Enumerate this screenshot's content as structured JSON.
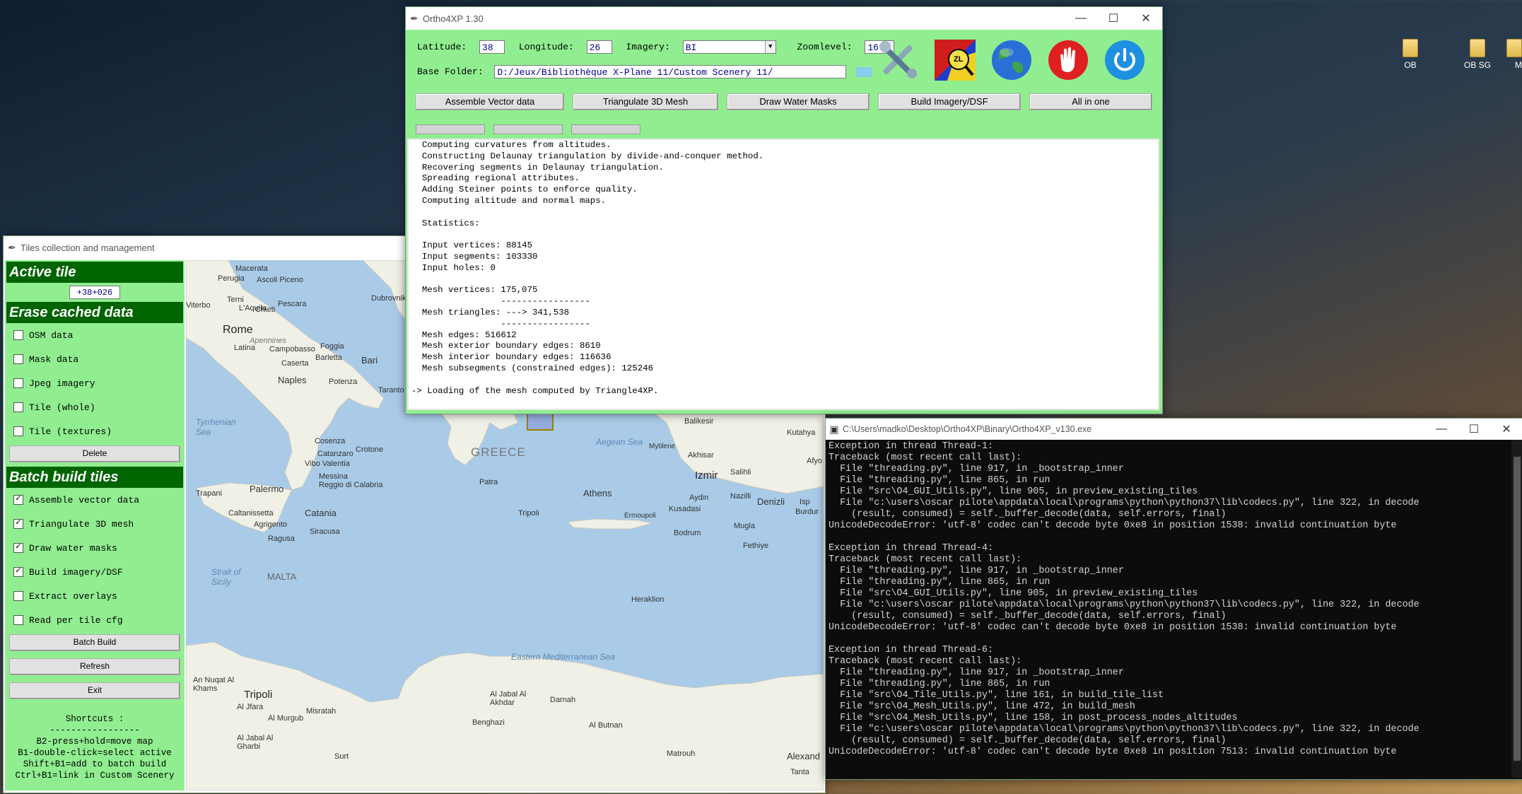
{
  "desktop": {
    "icons": [
      {
        "label": "OB"
      },
      {
        "label": "OB SG"
      },
      {
        "label": "M"
      }
    ]
  },
  "ortho": {
    "title": "Ortho4XP 1.30",
    "latitude_label": "Latitude:",
    "latitude_value": "38",
    "longitude_label": "Longitude:",
    "longitude_value": "26",
    "imagery_label": "Imagery:",
    "imagery_value": "BI",
    "zoom_label": "Zoomlevel:",
    "zoom_value": "16",
    "base_folder_label": "Base Folder:",
    "base_folder_value": "D:/Jeux/Bibliothèque X-Plane 11/Custom Scenery 11/",
    "buttons": {
      "assemble": "Assemble Vector data",
      "triangulate": "Triangulate 3D Mesh",
      "water": "Draw Water Masks",
      "build": "Build Imagery/DSF",
      "allinone": "All in one"
    },
    "zl_text": "ZL",
    "log": "  Computing curvatures from altitudes.\n  Constructing Delaunay triangulation by divide-and-conquer method.\n  Recovering segments in Delaunay triangulation.\n  Spreading regional attributes.\n  Adding Steiner points to enforce quality.\n  Computing altitude and normal maps.\n\n  Statistics:\n\n  Input vertices: 88145\n  Input segments: 103330\n  Input holes: 0\n\n  Mesh vertices: 175,075\n                 -----------------\n  Mesh triangles: ---> 341,538\n                 -----------------\n  Mesh edges: 516612\n  Mesh exterior boundary edges: 8610\n  Mesh interior boundary edges: 116636\n  Mesh subsegments (constrained edges): 125246\n\n-> Loading of the mesh computed by Triangle4XP."
  },
  "tiles": {
    "title": "Tiles collection and management",
    "active_tile_header": "Active tile",
    "active_tile_value": "+38+026",
    "erase_header": "Erase cached data",
    "erase_items": [
      "OSM data",
      "Mask data",
      "Jpeg imagery",
      "Tile (whole)",
      "Tile (textures)"
    ],
    "delete_label": "Delete",
    "batch_header": "Batch build tiles",
    "batch_items": [
      {
        "label": "Assemble vector data",
        "checked": "✓"
      },
      {
        "label": "Triangulate 3D mesh",
        "checked": "✓"
      },
      {
        "label": "Draw water masks",
        "checked": "✓"
      },
      {
        "label": "Build imagery/DSF",
        "checked": "✓"
      },
      {
        "label": "Extract overlays",
        "checked": ""
      },
      {
        "label": "Read per tile cfg",
        "checked": ""
      }
    ],
    "batch_build_label": "Batch Build",
    "refresh_label": "Refresh",
    "exit_label": "Exit",
    "shortcuts": [
      "Shortcuts :",
      "-----------------",
      "B2-press+hold=move map",
      "B1-double-click=select active",
      "Shift+B1=add to batch build",
      "Ctrl+B1=link in Custom Scenery"
    ],
    "map_labels": [
      "Macerata",
      "Perugia",
      "Ascoli Piceno",
      "Terni",
      "L'Aquila",
      "Chieti",
      "Pescara",
      "Viterbo",
      "Rome",
      "Apennines",
      "Latina",
      "Campobasso",
      "Foggia",
      "Barletta",
      "Bari",
      "Caserta",
      "Naples",
      "Potenza",
      "Taranto",
      "Cosenza",
      "Catanzaro",
      "Crotone",
      "Vibo Valentia",
      "Reggio di Calabria",
      "Messina",
      "Palermo",
      "Trapani",
      "Caltanissetta",
      "Agrigento",
      "Catania",
      "Ragusa",
      "Siracusa",
      "MALTA",
      "Dubrovnik",
      "GREECE",
      "Patra",
      "Athens",
      "Tripoli",
      "Ermoupoli",
      "Mytilene",
      "Balikesir",
      "Kutahya",
      "Akhisar",
      "Izmir",
      "Salihli",
      "Afyo",
      "Aydin",
      "Nazilli",
      "Denizli",
      "Isp",
      "Burdur",
      "Kusadasi",
      "Bodrum",
      "Mugla",
      "Fethiye",
      "Heraklion",
      "Tripoli",
      "Al Jfara",
      "Al Murgub",
      "Misratah",
      "Al Jabal Al Gharbi",
      "An Nuqat Al Khams",
      "Al Jabal Al Akhdar",
      "Darnah",
      "Benghazi",
      "Al Butnan",
      "Surt",
      "Matrouh",
      "Alexand",
      "Tanta"
    ],
    "sea_labels": [
      "Tyrrhenian Sea",
      "Aegean Sea",
      "Strait of Sicily",
      "Eastern Mediterranean Sea"
    ]
  },
  "console": {
    "title": "C:\\Users\\madko\\Desktop\\Ortho4XP\\Binary\\Ortho4XP_v130.exe",
    "text": "Exception in thread Thread-1:\nTraceback (most recent call last):\n  File \"threading.py\", line 917, in _bootstrap_inner\n  File \"threading.py\", line 865, in run\n  File \"src\\O4_GUI_Utils.py\", line 905, in preview_existing_tiles\n  File \"c:\\users\\oscar pilote\\appdata\\local\\programs\\python\\python37\\lib\\codecs.py\", line 322, in decode\n    (result, consumed) = self._buffer_decode(data, self.errors, final)\nUnicodeDecodeError: 'utf-8' codec can't decode byte 0xe8 in position 1538: invalid continuation byte\n\nException in thread Thread-4:\nTraceback (most recent call last):\n  File \"threading.py\", line 917, in _bootstrap_inner\n  File \"threading.py\", line 865, in run\n  File \"src\\O4_GUI_Utils.py\", line 905, in preview_existing_tiles\n  File \"c:\\users\\oscar pilote\\appdata\\local\\programs\\python\\python37\\lib\\codecs.py\", line 322, in decode\n    (result, consumed) = self._buffer_decode(data, self.errors, final)\nUnicodeDecodeError: 'utf-8' codec can't decode byte 0xe8 in position 1538: invalid continuation byte\n\nException in thread Thread-6:\nTraceback (most recent call last):\n  File \"threading.py\", line 917, in _bootstrap_inner\n  File \"threading.py\", line 865, in run\n  File \"src\\O4_Tile_Utils.py\", line 161, in build_tile_list\n  File \"src\\O4_Mesh_Utils.py\", line 472, in build_mesh\n  File \"src\\O4_Mesh_Utils.py\", line 158, in post_process_nodes_altitudes\n  File \"c:\\users\\oscar pilote\\appdata\\local\\programs\\python\\python37\\lib\\codecs.py\", line 322, in decode\n    (result, consumed) = self._buffer_decode(data, self.errors, final)\nUnicodeDecodeError: 'utf-8' codec can't decode byte 0xe8 in position 7513: invalid continuation byte"
  }
}
